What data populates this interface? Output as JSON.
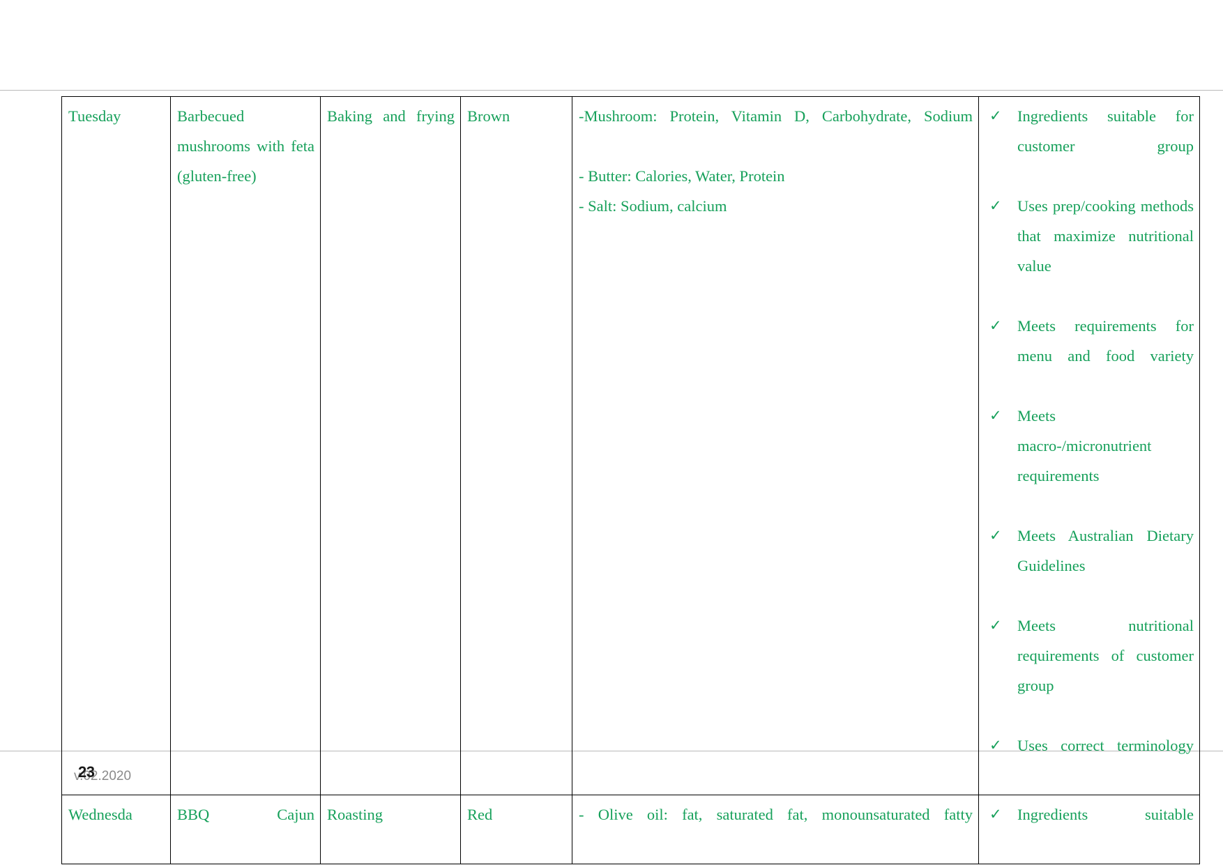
{
  "document": {
    "page_number": "23",
    "footer_date": "v.02.2020"
  },
  "colors": {
    "text_green": "#16a05a",
    "border_black": "#000000",
    "page_rule": "#b9b9b9",
    "footer_gray": "#8a8a8a"
  },
  "table": {
    "rows": [
      {
        "day": "Tuesday",
        "dish": "Barbecued mushrooms with feta (gluten-free)",
        "method": "Baking and frying",
        "colour": "Brown",
        "nutrients": [
          "-Mushroom: Protein, Vitamin D, Carbohydrate, Sodium",
          "- Butter: Calories, Water, Protein",
          "- Salt: Sodium, calcium"
        ],
        "checklist": [
          "Ingredients suitable for customer group",
          "Uses prep/cooking methods that maximize nutritional value",
          "Meets requirements for menu and food variety",
          "Meets macro-/micronutrient requirements",
          "Meets Australian Dietary Guidelines",
          "Meets nutritional requirements of customer group",
          "Uses correct terminology"
        ]
      },
      {
        "day": "Wednesda",
        "dish": "BBQ Cajun",
        "method": "Roasting",
        "colour": "Red",
        "nutrients": [
          "- Olive oil: fat, saturated fat, monounsaturated fatty"
        ],
        "checklist": [
          "Ingredients suitable"
        ]
      }
    ]
  },
  "icons": {
    "check": "✓"
  }
}
